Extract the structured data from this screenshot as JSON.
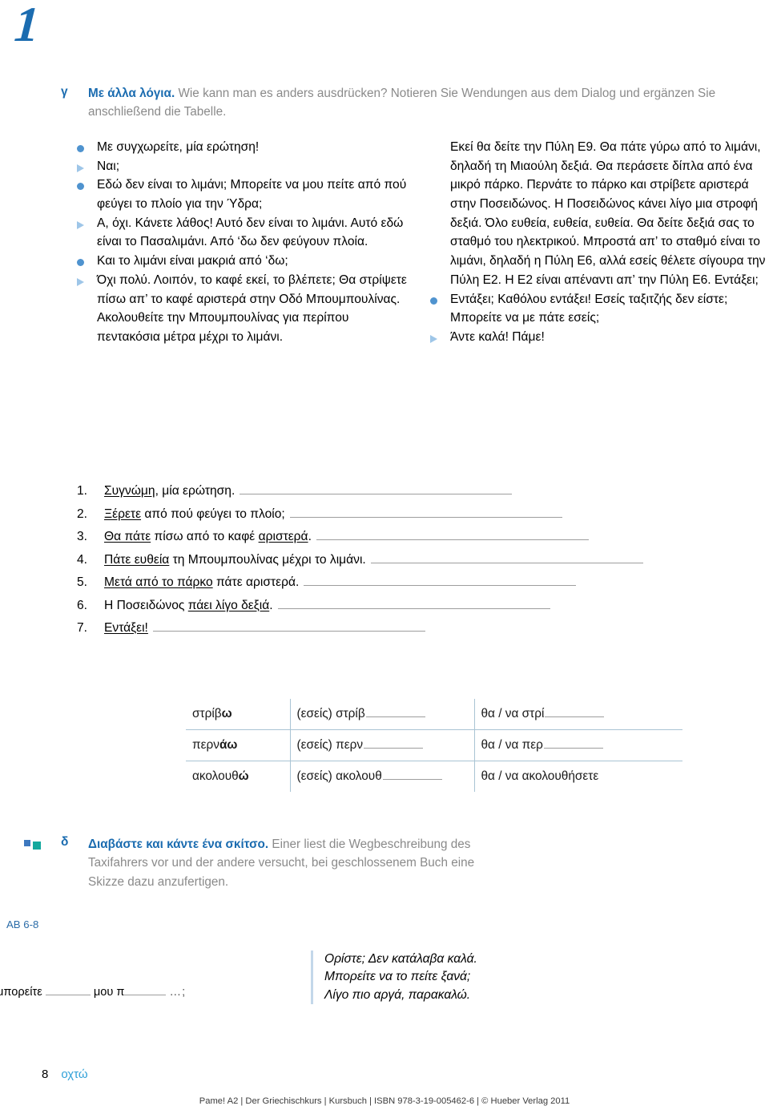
{
  "chapter_number": "1",
  "exercise_gamma": {
    "letter": "γ",
    "instruction_greek": "Με άλλα λόγια.",
    "instruction_german": " Wie kann man es anders ausdrücken? Notieren Sie Wendungen aus dem Dialog und ergänzen Sie anschließend die Tabelle.",
    "dialogue_left": [
      {
        "marker": "dot",
        "text": "Με συγχωρείτε, μία ερώτηση!"
      },
      {
        "marker": "triangle",
        "text": "Ναι;"
      },
      {
        "marker": "dot",
        "text": "Εδώ δεν είναι το λιμάνι; Μπορείτε να μου πείτε από πού φεύγει το πλοίο για την Ύδρα;"
      },
      {
        "marker": "triangle",
        "text": "Α, όχι. Κάνετε λάθος! Αυτό δεν είναι το λιμάνι. Αυτό εδώ είναι το Πασαλιμάνι. Από ‘δω δεν φεύγουν πλοία."
      },
      {
        "marker": "dot",
        "text": "Και το λιμάνι είναι μακριά από ‘δω;"
      },
      {
        "marker": "triangle",
        "text": "Όχι πολύ. Λοιπόν, το καφέ εκεί, το βλέπετε; Θα στρίψετε πίσω απ’ το καφέ αριστερά στην Οδό Μπουμπουλίνας. Ακολουθείτε την Μπουμπουλίνας για περίπου πεντακόσια μέτρα μέχρι το λιμάνι."
      }
    ],
    "dialogue_right": [
      {
        "marker": "none",
        "text": "Εκεί θα δείτε την Πύλη Ε9. Θα πάτε γύρω από το λιμάνι, δηλαδή τη Μιαούλη δεξιά. Θα περάσετε δίπλα από ένα μικρό πάρκο. Περνάτε το πάρκο και στρίβετε αριστερά στην Ποσειδώνος. Η Ποσειδώνος κάνει λίγο μια στροφή δεξιά. Όλο ευθεία, ευθεία, ευθεία. Θα δείτε δεξιά σας το σταθμό του ηλεκτρικού. Μπροστά απ’ το σταθμό είναι το λιμάνι, δηλαδή η Πύλη Ε6, αλλά εσείς θέλετε σίγουρα την Πύλη Ε2. Η Ε2 είναι απέναντι απ’ την Πύλη Ε6. Εντάξει;"
      },
      {
        "marker": "dot",
        "text": "Εντάξει; Καθόλου εντάξει! Εσείς ταξιτζής δεν είστε; Μπορείτε να με πάτε εσείς;"
      },
      {
        "marker": "triangle",
        "text": "Άντε καλά! Πάμε!"
      }
    ],
    "numbered_answers": [
      {
        "index": "1.",
        "underlined": "Συγνώμη",
        "rest": ", μία ερώτηση."
      },
      {
        "index": "2.",
        "underlined": "Ξέρετε",
        "rest": " από πού φεύγει το πλοίο;"
      },
      {
        "index": "3.",
        "underlined": "Θα πάτε",
        "rest": " πίσω από το καφέ ",
        "underlined2": "αριστερά",
        "rest2": "."
      },
      {
        "index": "4.",
        "underlined": "Πάτε ευθεία",
        "rest": " τη Μπουμπουλίνας μέχρι το λιμάνι."
      },
      {
        "index": "5.",
        "underlined": "Μετά από το πάρκο",
        "rest": " πάτε αριστερά."
      },
      {
        "index": "6.",
        "underlined": "",
        "rest": "Η Ποσειδώνος ",
        "underlined2": "πάει λίγο δεξιά",
        "rest2": "."
      },
      {
        "index": "7.",
        "underlined": "Εντάξει!",
        "rest": ""
      }
    ],
    "table": {
      "rows": [
        {
          "c1_stem": "στρίβ",
          "c1_end": "ω",
          "c2_prefix": "(εσείς) στρίβ",
          "c2_blank": true,
          "c3_text": "θα / να στρί",
          "c3_blank": true
        },
        {
          "c1_stem": "περν",
          "c1_end": "άω",
          "c2_prefix": "(εσείς) περν",
          "c2_blank": true,
          "c3_text": "θα / να περ",
          "c3_blank": true
        },
        {
          "c1_stem": "ακολουθ",
          "c1_end": "ώ",
          "c2_prefix": "(εσείς) ακολουθ",
          "c2_blank": true,
          "c3_text": "θα / να ακολουθήσετε",
          "c3_blank": false
        }
      ]
    }
  },
  "exercise_delta": {
    "letter": "δ",
    "instruction_greek": "Διαβάστε και κάντε ένα σκίτσο.",
    "instruction_german": " Einer liest die Wegbeschreibung des Taxifahrers vor und der andere versucht, bei geschlossenem Buch eine Skizze dazu anzufertigen.",
    "ab_reference": "AB 6-8"
  },
  "bottom_fill": {
    "word1": "μπορείτε",
    "word2": "μου π",
    "dots": "…;"
  },
  "speech_bubble": {
    "line1": "Ορίστε; Δεν κατάλαβα καλά.",
    "line2": "Μπορείτε να το πείτε ξανά;",
    "line3": "Λίγο πιο αργά, παρακαλώ."
  },
  "footer": {
    "page_number": "8",
    "page_word": "οχτώ",
    "imprint": "Pame! A2 | Der Griechischkurs | Kursbuch | ISBN 978-3-19-005462-6 | © Hueber Verlag 2011"
  },
  "colors": {
    "accent_blue": "#1b6cb0",
    "bullet_dot": "#4f93cf",
    "bullet_triangle": "#9ec6e8",
    "teal_square": "#13a89e",
    "instruction_gray": "#8a8a8a",
    "page_word_blue": "#2fa0d8",
    "table_border": "#a9c4d4"
  }
}
